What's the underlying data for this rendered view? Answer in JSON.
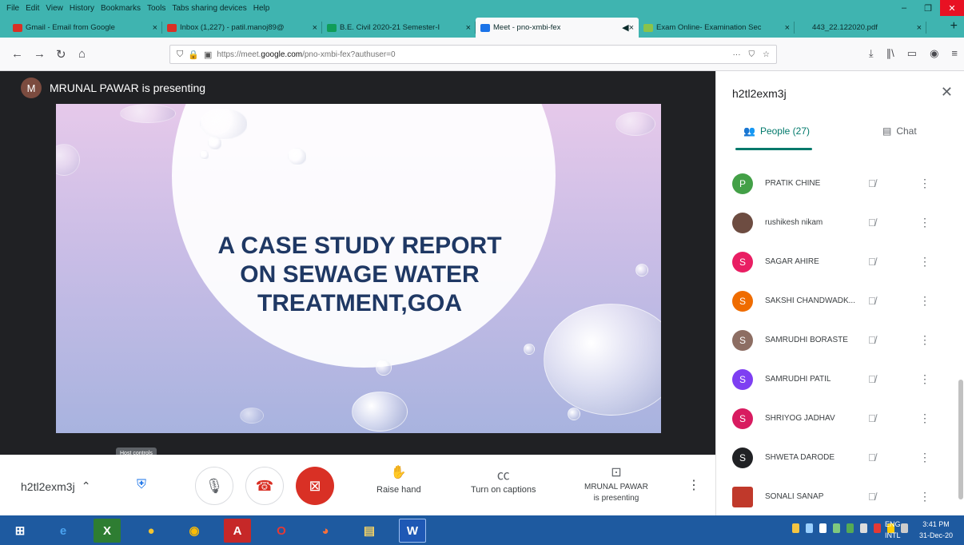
{
  "browser": {
    "menu": [
      "File",
      "Edit",
      "View",
      "History",
      "Bookmarks",
      "Tools",
      "Tabs sharing devices",
      "Help"
    ],
    "tabs": [
      {
        "label": "Gmail - Email from Google",
        "color": "#d93025"
      },
      {
        "label": "Inbox (1,227) - patil.manoj89@",
        "color": "#d93025"
      },
      {
        "label": "B.E. Civil 2020-21 Semester-I",
        "color": "#0f9d58"
      },
      {
        "label": "Meet - pno-xmbi-fex",
        "color": "#1a73e8",
        "active": true
      },
      {
        "label": "Exam Online- Examination Sec",
        "color": "#8bc34a"
      },
      {
        "label": "443_22.122020.pdf",
        "color": "#3fb4b0"
      }
    ],
    "url_prefix": "https://meet.",
    "url_host": "google.com",
    "url_suffix": "/pno-xmbi-fex?authuser=0"
  },
  "meet": {
    "presenter_initial": "M",
    "presenter_text": "MRUNAL PAWAR is presenting",
    "slide_title_lines": [
      "A CASE STUDY REPORT",
      "ON  SEWAGE WATER",
      "TREATMENT,GOA"
    ],
    "meeting_code": "h2tl2exm3j",
    "tooltip": "Host controls",
    "raise_hand": "Raise hand",
    "captions": "Turn on captions",
    "presenting_line1": "MRUNAL PAWAR",
    "presenting_line2": "is presenting"
  },
  "panel": {
    "title": "h2tl2exm3j",
    "people_tab": "People (27)",
    "chat_tab": "Chat",
    "participants": [
      {
        "name": "PRATIK CHINE",
        "initial": "P",
        "color": "#43a047"
      },
      {
        "name": "rushikesh nikam",
        "initial": "",
        "color": "#6d4c41",
        "photo": true
      },
      {
        "name": "SAGAR AHIRE",
        "initial": "S",
        "color": "#e91e63"
      },
      {
        "name": "SAKSHI CHANDWADK...",
        "initial": "S",
        "color": "#ef6c00"
      },
      {
        "name": "SAMRUDHI BORASTE",
        "initial": "S",
        "color": "#8d6e63"
      },
      {
        "name": "SAMRUDHI PATIL",
        "initial": "S",
        "color": "#7e3ff2"
      },
      {
        "name": "SHRIYOG JADHAV",
        "initial": "S",
        "color": "#d81b60"
      },
      {
        "name": "SHWETA DARODE",
        "initial": "S",
        "color": "#202124"
      },
      {
        "name": "SONALI SANAP",
        "initial": "",
        "color": "#c0392b",
        "photo": true
      }
    ]
  },
  "taskbar": {
    "lang_line1": "ENG",
    "lang_line2": "INTL",
    "time": "3:41 PM",
    "date": "31-Dec-20"
  }
}
